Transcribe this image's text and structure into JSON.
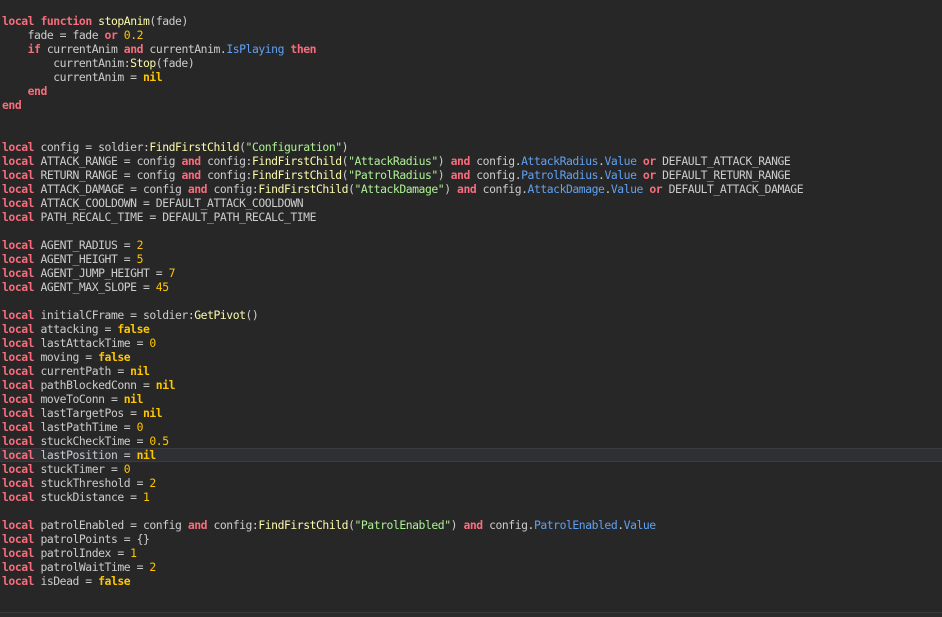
{
  "editor": {
    "current_line_index": 31,
    "colors": {
      "background": "#272727",
      "keyword": "#f86d7c",
      "function": "#fdfbac",
      "string": "#adf195",
      "number": "#ffc600",
      "property": "#61a1f1",
      "identifier": "#cccccc"
    },
    "lines": [
      [
        [
          "kw",
          "local"
        ],
        [
          "id",
          " "
        ],
        [
          "kw",
          "function"
        ],
        [
          "id",
          " "
        ],
        [
          "fn",
          "stopAnim"
        ],
        [
          "id",
          "(fade)"
        ]
      ],
      [
        [
          "id",
          "    fade = fade "
        ],
        [
          "kw",
          "or"
        ],
        [
          "id",
          " "
        ],
        [
          "num",
          "0.2"
        ]
      ],
      [
        [
          "id",
          "    "
        ],
        [
          "kw",
          "if"
        ],
        [
          "id",
          " currentAnim "
        ],
        [
          "kw",
          "and"
        ],
        [
          "id",
          " currentAnim."
        ],
        [
          "prop",
          "IsPlaying"
        ],
        [
          "id",
          " "
        ],
        [
          "kw",
          "then"
        ]
      ],
      [
        [
          "id",
          "        currentAnim:"
        ],
        [
          "fn",
          "Stop"
        ],
        [
          "id",
          "(fade)"
        ]
      ],
      [
        [
          "id",
          "        currentAnim = "
        ],
        [
          "lit",
          "nil"
        ]
      ],
      [
        [
          "id",
          "    "
        ],
        [
          "kw",
          "end"
        ]
      ],
      [
        [
          "kw",
          "end"
        ]
      ],
      [],
      [],
      [
        [
          "kw",
          "local"
        ],
        [
          "id",
          " config = soldier:"
        ],
        [
          "fn",
          "FindFirstChild"
        ],
        [
          "id",
          "("
        ],
        [
          "str",
          "\"Configuration\""
        ],
        [
          "id",
          ")"
        ]
      ],
      [
        [
          "kw",
          "local"
        ],
        [
          "id",
          " ATTACK_RANGE = config "
        ],
        [
          "kw",
          "and"
        ],
        [
          "id",
          " config:"
        ],
        [
          "fn",
          "FindFirstChild"
        ],
        [
          "id",
          "("
        ],
        [
          "str",
          "\"AttackRadius\""
        ],
        [
          "id",
          ") "
        ],
        [
          "kw",
          "and"
        ],
        [
          "id",
          " config."
        ],
        [
          "prop",
          "AttackRadius"
        ],
        [
          "id",
          "."
        ],
        [
          "prop",
          "Value"
        ],
        [
          "id",
          " "
        ],
        [
          "kw",
          "or"
        ],
        [
          "id",
          " DEFAULT_ATTACK_RANGE"
        ]
      ],
      [
        [
          "kw",
          "local"
        ],
        [
          "id",
          " RETURN_RANGE = config "
        ],
        [
          "kw",
          "and"
        ],
        [
          "id",
          " config:"
        ],
        [
          "fn",
          "FindFirstChild"
        ],
        [
          "id",
          "("
        ],
        [
          "str",
          "\"PatrolRadius\""
        ],
        [
          "id",
          ") "
        ],
        [
          "kw",
          "and"
        ],
        [
          "id",
          " config."
        ],
        [
          "prop",
          "PatrolRadius"
        ],
        [
          "id",
          "."
        ],
        [
          "prop",
          "Value"
        ],
        [
          "id",
          " "
        ],
        [
          "kw",
          "or"
        ],
        [
          "id",
          " DEFAULT_RETURN_RANGE"
        ]
      ],
      [
        [
          "kw",
          "local"
        ],
        [
          "id",
          " ATTACK_DAMAGE = config "
        ],
        [
          "kw",
          "and"
        ],
        [
          "id",
          " config:"
        ],
        [
          "fn",
          "FindFirstChild"
        ],
        [
          "id",
          "("
        ],
        [
          "str",
          "\"AttackDamage\""
        ],
        [
          "id",
          ") "
        ],
        [
          "kw",
          "and"
        ],
        [
          "id",
          " config."
        ],
        [
          "prop",
          "AttackDamage"
        ],
        [
          "id",
          "."
        ],
        [
          "prop",
          "Value"
        ],
        [
          "id",
          " "
        ],
        [
          "kw",
          "or"
        ],
        [
          "id",
          " DEFAULT_ATTACK_DAMAGE"
        ]
      ],
      [
        [
          "kw",
          "local"
        ],
        [
          "id",
          " ATTACK_COOLDOWN = DEFAULT_ATTACK_COOLDOWN"
        ]
      ],
      [
        [
          "kw",
          "local"
        ],
        [
          "id",
          " PATH_RECALC_TIME = DEFAULT_PATH_RECALC_TIME"
        ]
      ],
      [],
      [
        [
          "kw",
          "local"
        ],
        [
          "id",
          " AGENT_RADIUS = "
        ],
        [
          "num",
          "2"
        ]
      ],
      [
        [
          "kw",
          "local"
        ],
        [
          "id",
          " AGENT_HEIGHT = "
        ],
        [
          "num",
          "5"
        ]
      ],
      [
        [
          "kw",
          "local"
        ],
        [
          "id",
          " AGENT_JUMP_HEIGHT = "
        ],
        [
          "num",
          "7"
        ]
      ],
      [
        [
          "kw",
          "local"
        ],
        [
          "id",
          " AGENT_MAX_SLOPE = "
        ],
        [
          "num",
          "45"
        ]
      ],
      [],
      [
        [
          "kw",
          "local"
        ],
        [
          "id",
          " initialCFrame = soldier:"
        ],
        [
          "fn",
          "GetPivot"
        ],
        [
          "id",
          "()"
        ]
      ],
      [
        [
          "kw",
          "local"
        ],
        [
          "id",
          " attacking = "
        ],
        [
          "lit",
          "false"
        ]
      ],
      [
        [
          "kw",
          "local"
        ],
        [
          "id",
          " lastAttackTime = "
        ],
        [
          "num",
          "0"
        ]
      ],
      [
        [
          "kw",
          "local"
        ],
        [
          "id",
          " moving = "
        ],
        [
          "lit",
          "false"
        ]
      ],
      [
        [
          "kw",
          "local"
        ],
        [
          "id",
          " currentPath = "
        ],
        [
          "lit",
          "nil"
        ]
      ],
      [
        [
          "kw",
          "local"
        ],
        [
          "id",
          " pathBlockedConn = "
        ],
        [
          "lit",
          "nil"
        ]
      ],
      [
        [
          "kw",
          "local"
        ],
        [
          "id",
          " moveToConn = "
        ],
        [
          "lit",
          "nil"
        ]
      ],
      [
        [
          "kw",
          "local"
        ],
        [
          "id",
          " lastTargetPos = "
        ],
        [
          "lit",
          "nil"
        ]
      ],
      [
        [
          "kw",
          "local"
        ],
        [
          "id",
          " lastPathTime = "
        ],
        [
          "num",
          "0"
        ]
      ],
      [
        [
          "kw",
          "local"
        ],
        [
          "id",
          " stuckCheckTime = "
        ],
        [
          "num",
          "0.5"
        ]
      ],
      [
        [
          "kw",
          "local"
        ],
        [
          "id",
          " lastPosition = "
        ],
        [
          "lit",
          "nil"
        ]
      ],
      [
        [
          "kw",
          "local"
        ],
        [
          "id",
          " stuckTimer = "
        ],
        [
          "num",
          "0"
        ]
      ],
      [
        [
          "kw",
          "local"
        ],
        [
          "id",
          " stuckThreshold = "
        ],
        [
          "num",
          "2"
        ]
      ],
      [
        [
          "kw",
          "local"
        ],
        [
          "id",
          " stuckDistance = "
        ],
        [
          "num",
          "1"
        ]
      ],
      [],
      [
        [
          "kw",
          "local"
        ],
        [
          "id",
          " patrolEnabled = config "
        ],
        [
          "kw",
          "and"
        ],
        [
          "id",
          " config:"
        ],
        [
          "fn",
          "FindFirstChild"
        ],
        [
          "id",
          "("
        ],
        [
          "str",
          "\"PatrolEnabled\""
        ],
        [
          "id",
          ") "
        ],
        [
          "kw",
          "and"
        ],
        [
          "id",
          " config."
        ],
        [
          "prop",
          "PatrolEnabled"
        ],
        [
          "id",
          "."
        ],
        [
          "prop",
          "Value"
        ]
      ],
      [
        [
          "kw",
          "local"
        ],
        [
          "id",
          " patrolPoints = {}"
        ]
      ],
      [
        [
          "kw",
          "local"
        ],
        [
          "id",
          " patrolIndex = "
        ],
        [
          "num",
          "1"
        ]
      ],
      [
        [
          "kw",
          "local"
        ],
        [
          "id",
          " patrolWaitTime = "
        ],
        [
          "num",
          "2"
        ]
      ],
      [
        [
          "kw",
          "local"
        ],
        [
          "id",
          " isDead = "
        ],
        [
          "lit",
          "false"
        ]
      ]
    ]
  }
}
